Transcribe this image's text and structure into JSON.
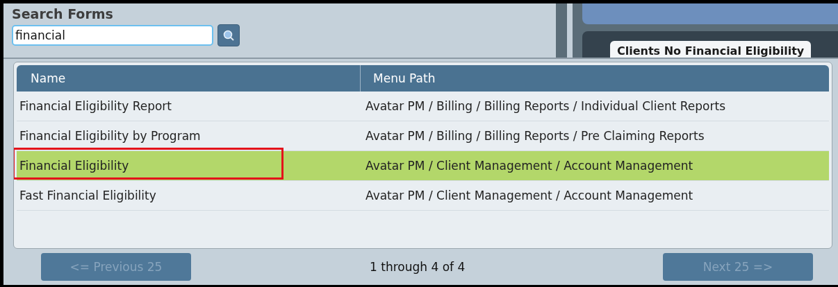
{
  "search": {
    "title": "Search Forms",
    "value": "financial"
  },
  "tab": {
    "label": "Clients No Financial Eligibility"
  },
  "table": {
    "columns": [
      "Name",
      "Menu Path"
    ],
    "rows": [
      {
        "name": "Financial Eligibility Report",
        "path": "Avatar PM / Billing / Billing Reports / Individual Client Reports",
        "selected": false,
        "outlined": false
      },
      {
        "name": "Financial Eligibility by Program",
        "path": "Avatar PM / Billing / Billing Reports / Pre Claiming Reports",
        "selected": false,
        "outlined": false
      },
      {
        "name": "Financial Eligibility",
        "path": "Avatar PM / Client Management / Account Management",
        "selected": true,
        "outlined": true
      },
      {
        "name": "Fast Financial Eligibility",
        "path": "Avatar PM / Client Management / Account Management",
        "selected": false,
        "outlined": false
      }
    ]
  },
  "pager": {
    "previous": {
      "label": "<= Previous 25",
      "disabled": true
    },
    "status": "1 through 4 of 4",
    "next": {
      "label": "Next 25 =>",
      "disabled": true
    }
  }
}
